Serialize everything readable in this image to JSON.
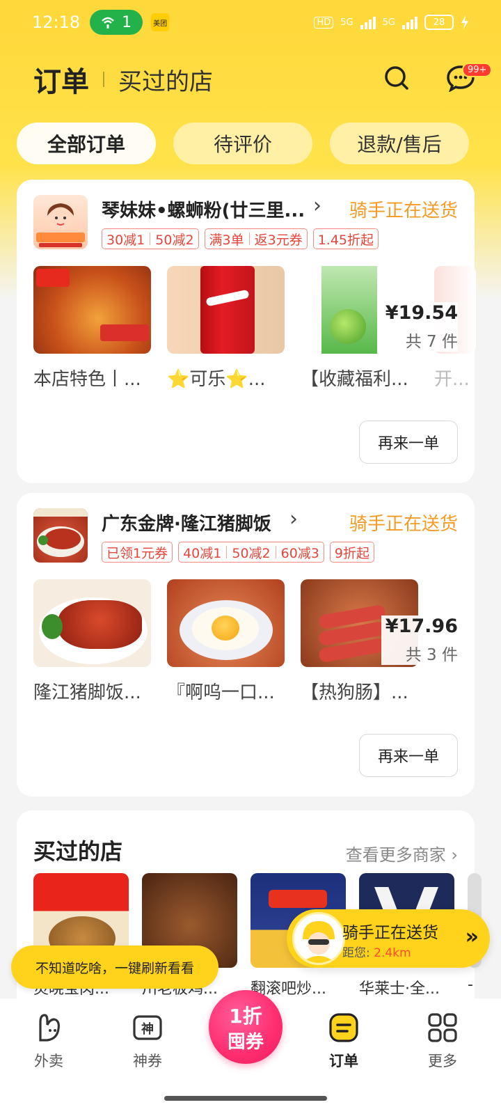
{
  "status_bar": {
    "time": "12:18",
    "hotspot_count": "1",
    "app_badge": "美团",
    "hd": "HD",
    "net1": "5G",
    "net2": "5G",
    "battery": "28"
  },
  "header": {
    "title": "订单",
    "subtitle": "买过的店",
    "message_badge": "99+"
  },
  "tabs": [
    {
      "label": "全部订单",
      "active": true
    },
    {
      "label": "待评价",
      "active": false
    },
    {
      "label": "退款/售后",
      "active": false
    }
  ],
  "orders": [
    {
      "shop_name": "琴妹妹•螺蛳粉(廿三里...",
      "status": "骑手正在送货",
      "tags": [
        {
          "parts": [
            "30减1",
            "50减2"
          ]
        },
        {
          "parts": [
            "满3单",
            "返3元券"
          ]
        },
        {
          "parts": [
            "1.45折起"
          ]
        }
      ],
      "items": [
        {
          "name": "本店特色丨..."
        },
        {
          "name": "⭐可乐⭐..."
        },
        {
          "name": "【收藏福利..."
        },
        {
          "name": "开..."
        }
      ],
      "price": "¥19.54",
      "count": "共 7 件",
      "reorder_label": "再来一单"
    },
    {
      "shop_name": "广东金牌·隆江猪脚饭",
      "status": "骑手正在送货",
      "tags": [
        {
          "parts": [
            "已领1元券"
          ]
        },
        {
          "parts": [
            "40减1",
            "50减2",
            "60减3"
          ]
        },
        {
          "parts": [
            "9折起"
          ]
        }
      ],
      "items": [
        {
          "name": "隆江猪脚饭..."
        },
        {
          "name": "『啊呜一口..."
        },
        {
          "name": "【热狗肠】..."
        }
      ],
      "price": "¥17.96",
      "count": "共 3 件",
      "reorder_label": "再来一单"
    }
  ],
  "bought_shops": {
    "title": "买过的店",
    "more": "查看更多商家",
    "shops": [
      {
        "name": "灵晓宝肉..."
      },
      {
        "name": "川老板鸡..."
      },
      {
        "name": "翻滚吧炒..."
      },
      {
        "name": "华莱士·全..."
      },
      {
        "name": "-"
      }
    ]
  },
  "floating_rider": {
    "title": "骑手正在送货",
    "distance_label": "距您:",
    "distance": "2.4km"
  },
  "refresh_tip": "不知道吃啥，一键刷新看看",
  "bottom_nav": {
    "items": [
      {
        "label": "外卖"
      },
      {
        "label": "神券"
      },
      {
        "label": "订单"
      },
      {
        "label": "更多"
      }
    ],
    "center": {
      "line1": "1折",
      "line2": "囤券"
    }
  },
  "colors": {
    "brand_yellow": "#ffd83a",
    "status_orange": "#f59a23",
    "tag_red": "#e6453a",
    "center_pink": "#ff2d6f"
  }
}
